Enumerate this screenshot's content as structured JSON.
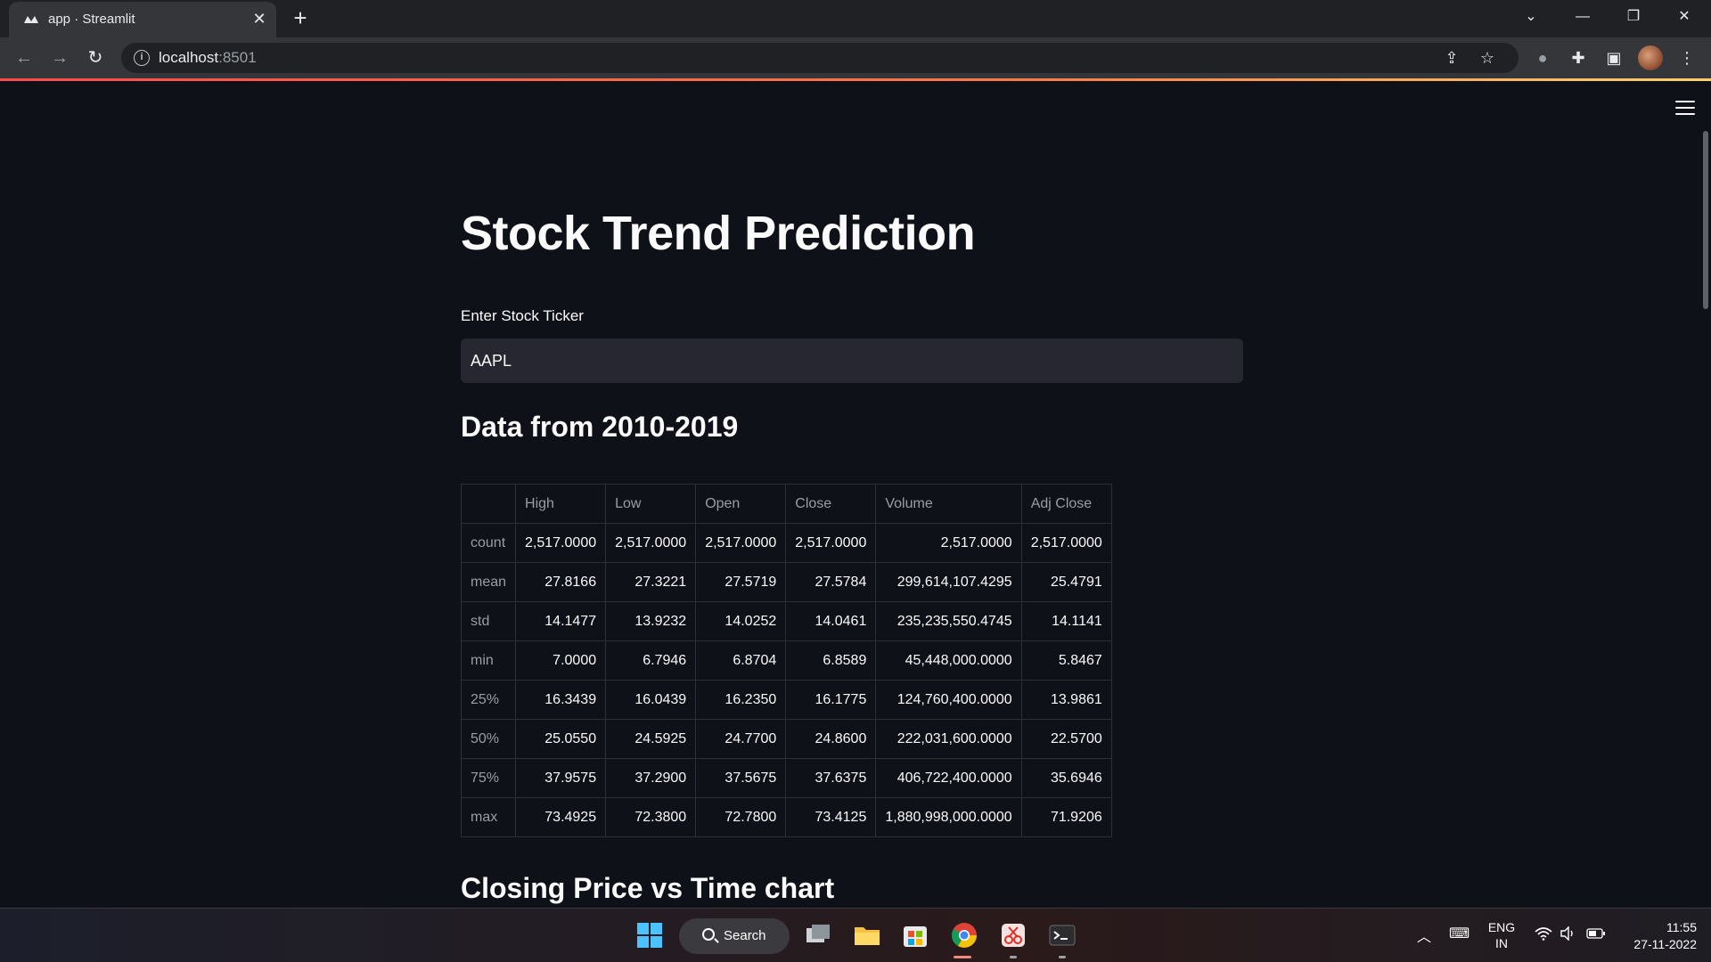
{
  "browser": {
    "tab_title": "app · Streamlit",
    "url_host": "localhost",
    "url_port": ":8501"
  },
  "app": {
    "title": "Stock Trend Prediction",
    "ticker_label": "Enter Stock Ticker",
    "ticker_value": "AAPL",
    "data_heading": "Data from 2010-2019",
    "chart_heading": "Closing Price vs Time chart"
  },
  "table": {
    "columns": [
      "",
      "High",
      "Low",
      "Open",
      "Close",
      "Volume",
      "Adj Close"
    ],
    "rows": [
      [
        "count",
        "2,517.0000",
        "2,517.0000",
        "2,517.0000",
        "2,517.0000",
        "2,517.0000",
        "2,517.0000"
      ],
      [
        "mean",
        "27.8166",
        "27.3221",
        "27.5719",
        "27.5784",
        "299,614,107.4295",
        "25.4791"
      ],
      [
        "std",
        "14.1477",
        "13.9232",
        "14.0252",
        "14.0461",
        "235,235,550.4745",
        "14.1141"
      ],
      [
        "min",
        "7.0000",
        "6.7946",
        "6.8704",
        "6.8589",
        "45,448,000.0000",
        "5.8467"
      ],
      [
        "25%",
        "16.3439",
        "16.0439",
        "16.2350",
        "16.1775",
        "124,760,400.0000",
        "13.9861"
      ],
      [
        "50%",
        "25.0550",
        "24.5925",
        "24.7700",
        "24.8600",
        "222,031,600.0000",
        "22.5700"
      ],
      [
        "75%",
        "37.9575",
        "37.2900",
        "37.5675",
        "37.6375",
        "406,722,400.0000",
        "35.6946"
      ],
      [
        "max",
        "73.4925",
        "72.3800",
        "72.7800",
        "73.4125",
        "1,880,998,000.0000",
        "71.9206"
      ]
    ]
  },
  "taskbar": {
    "search_label": "Search",
    "language": "ENG",
    "region": "IN",
    "time": "11:55",
    "date": "27-11-2022"
  },
  "colors": {
    "page_bg": "#0e1117",
    "input_bg": "#262730",
    "accent": "#ff4b4b"
  },
  "icons": [
    "streamlit-favicon",
    "close-icon",
    "plus-icon",
    "back-icon",
    "forward-icon",
    "reload-icon",
    "info-icon",
    "share-icon",
    "star-icon",
    "extension-icon",
    "puzzle-icon",
    "sidepanel-icon",
    "menu-icon",
    "hamburger-icon",
    "windows-start-icon",
    "search-icon",
    "wifi-icon",
    "volume-icon",
    "battery-icon"
  ]
}
